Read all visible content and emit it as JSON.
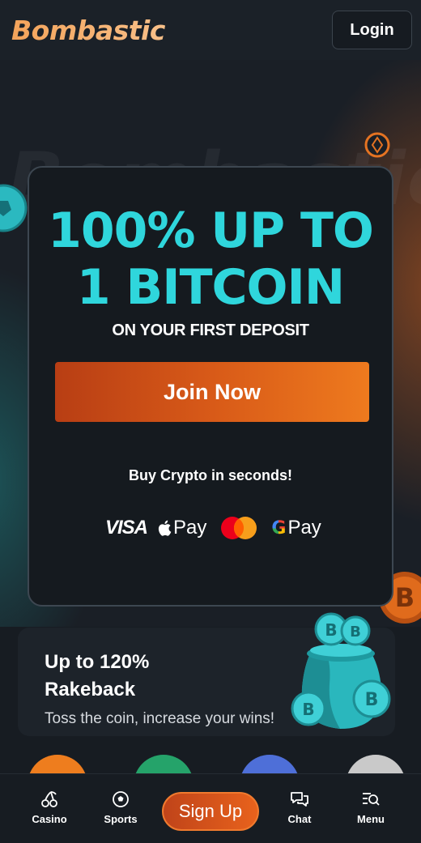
{
  "header": {
    "logo_text": "Bombastic",
    "login_label": "Login"
  },
  "hero": {
    "bg_word": "Bombastic",
    "headline_line1": "100% UP TO",
    "headline_line2": "1 BITCOIN",
    "subheadline": "ON YOUR FIRST DEPOSIT",
    "cta_label": "Join Now",
    "buy_crypto_text": "Buy Crypto in seconds!",
    "payment_methods": {
      "visa": "VISA",
      "apple_pay": "Pay",
      "mastercard": "mastercard-logo",
      "google_pay": "Pay",
      "google_g": "G"
    }
  },
  "rakeback": {
    "title": "Up to 120% Rakeback",
    "subtitle": "Toss the coin, increase your wins!"
  },
  "bottom_nav": {
    "items": [
      {
        "label": "Casino",
        "icon": "cherries-icon"
      },
      {
        "label": "Sports",
        "icon": "soccer-ball-icon"
      },
      {
        "label": "Chat",
        "icon": "chat-bubbles-icon"
      },
      {
        "label": "Menu",
        "icon": "menu-search-icon"
      }
    ],
    "signup_label": "Sign Up"
  },
  "colors": {
    "accent_orange": "#e8621c",
    "headline_cyan": "#2fd6dc",
    "logo_orange": "#f3a35a",
    "background": "#171c22"
  }
}
